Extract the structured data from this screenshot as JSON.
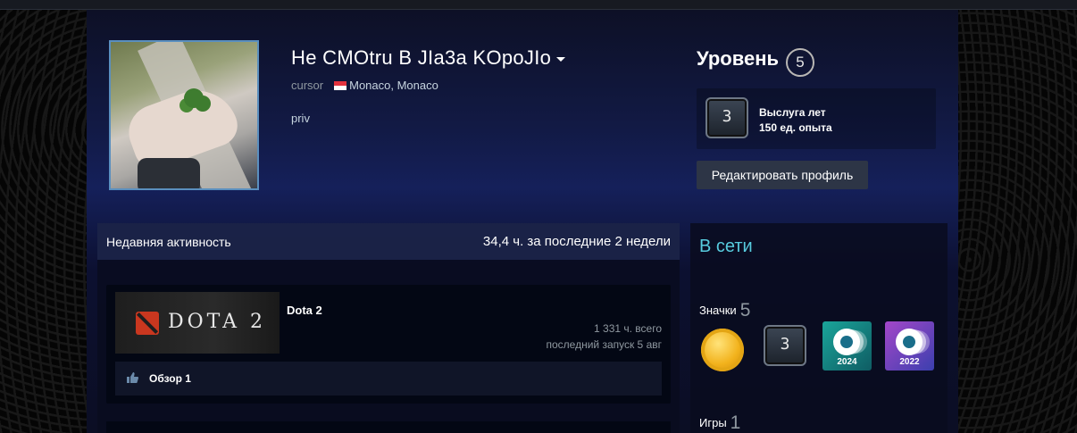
{
  "profile": {
    "persona_name": "Не CMOtru B JIa3a KOpoJIo",
    "real_name": "cursor",
    "location": "Monaco, Monaco",
    "summary": "priv"
  },
  "level": {
    "label": "Уровень",
    "value": "5"
  },
  "featured_badge": {
    "number": "3",
    "title": "Выслуга лет",
    "xp": "150 ед. опыта"
  },
  "edit_button": "Редактировать профиль",
  "recent_activity": {
    "title": "Недавняя активность",
    "hours": "34,4 ч. за последние 2 недели",
    "games": [
      {
        "name": "Dota 2",
        "logo_text": "DOTA 2",
        "total_hours": "1 331 ч. всего",
        "last_played": "последний запуск 5 авг",
        "review": "Обзор 1"
      }
    ]
  },
  "sidebar": {
    "status": "В сети",
    "badges_label": "Значки",
    "badges_count": "5",
    "badges": [
      {
        "name": "gold-coin-badge"
      },
      {
        "name": "years-of-service-badge",
        "number": "3"
      },
      {
        "name": "steam-2024-badge",
        "year": "2024"
      },
      {
        "name": "steam-2022-badge",
        "year": "2022"
      }
    ],
    "games_label": "Игры",
    "games_count": "1"
  },
  "colors": {
    "status_online": "#57cbde",
    "text_primary": "#ffffff",
    "text_muted": "#8f98a0"
  }
}
